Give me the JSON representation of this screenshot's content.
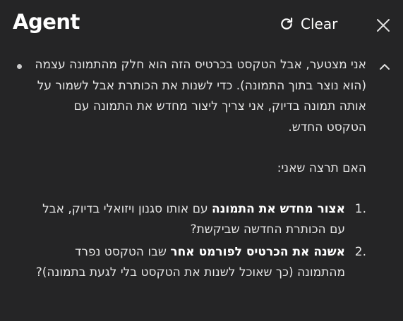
{
  "header": {
    "title": "Agent",
    "clear_label": "Clear"
  },
  "message": {
    "paragraph": "אני מצטער, אבל הטקסט בכרטיס הזה הוא חלק מהתמונה עצמה (הוא נוצר בתוך התמונה). כדי לשנות את הכותרת אבל לשמור על אותה תמונה בדיוק, אני צריך ליצור מחדש את התמונה עם הטקסט החדש.",
    "question": "האם תרצה שאני:",
    "options": [
      {
        "number": "1.",
        "bold": "אצור מחדש את התמונה",
        "rest": " עם אותו סגנון ויזואלי בדיוק, אבל עם הכותרת החדשה שביקשת?"
      },
      {
        "number": "2.",
        "bold": "אשנה את הכרטיס לפורמט אחר",
        "rest": " שבו הטקסט נפרד מהתמונה (כך שאוכל לשנות את הטקסט בלי לגעת בתמונה)?"
      }
    ]
  }
}
